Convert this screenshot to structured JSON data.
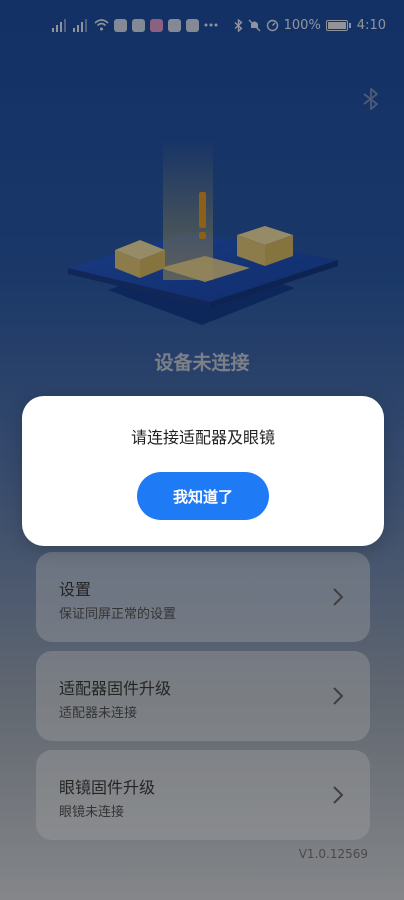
{
  "status_bar": {
    "battery": "100%",
    "time": "4:10",
    "icons_left": [
      "signal-1-icon",
      "signal-2-icon",
      "wifi-icon",
      "nfc-icon",
      "app-icon-1",
      "app-icon-2",
      "app-icon-3",
      "app-icon-4",
      "more-dots-icon"
    ],
    "icons_right": [
      "bluetooth-icon",
      "mute-icon",
      "data-saver-icon",
      "battery-icon"
    ]
  },
  "header": {
    "bluetooth_icon": "bluetooth-icon"
  },
  "main": {
    "status_title": "设备未连接"
  },
  "menu": {
    "items": [
      {
        "title": "设置",
        "subtitle": "保证同屏正常的设置"
      },
      {
        "title": "适配器固件升级",
        "subtitle": "适配器未连接"
      },
      {
        "title": "眼镜固件升级",
        "subtitle": "眼镜未连接"
      }
    ]
  },
  "version": "V1.0.12569",
  "dialog": {
    "message": "请连接适配器及眼镜",
    "button_label": "我知道了"
  },
  "colors": {
    "primary_button": "#1f7af5",
    "background_top": "#1f4fa4",
    "background_bottom": "#d6d9de"
  }
}
